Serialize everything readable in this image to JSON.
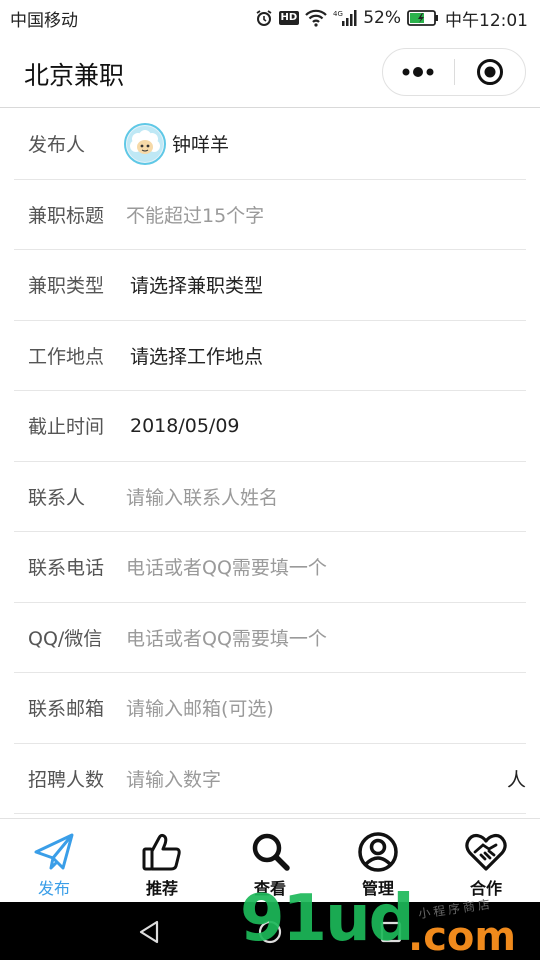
{
  "status_bar": {
    "carrier": "中国移动",
    "network": "4G",
    "battery": "52%",
    "time": "中午12:01",
    "icons": [
      "alarm-icon",
      "hd-icon",
      "wifi-icon",
      "signal-icon",
      "battery-icon"
    ]
  },
  "nav": {
    "title": "北京兼职",
    "more_icon": "more-dots-icon",
    "close_icon": "target-icon"
  },
  "form": {
    "publisher": {
      "label": "发布人",
      "name": "钟咩羊",
      "avatar_icon": "sheep-avatar-icon"
    },
    "title": {
      "label": "兼职标题",
      "placeholder": "不能超过15个字"
    },
    "type": {
      "label": "兼职类型",
      "value": "请选择兼职类型"
    },
    "location": {
      "label": "工作地点",
      "value": "请选择工作地点"
    },
    "deadline": {
      "label": "截止时间",
      "value": "2018/05/09"
    },
    "contact": {
      "label": "联系人",
      "placeholder": "请输入联系人姓名"
    },
    "phone": {
      "label": "联系电话",
      "placeholder": "电话或者QQ需要填一个"
    },
    "qq": {
      "label": "QQ/微信",
      "placeholder": "电话或者QQ需要填一个"
    },
    "email": {
      "label": "联系邮箱",
      "placeholder": "请输入邮箱(可选)"
    },
    "headcount": {
      "label": "招聘人数",
      "placeholder": "请输入数字",
      "unit": "人"
    }
  },
  "tabbar": {
    "tabs": [
      {
        "label": "发布",
        "icon": "paper-plane-icon",
        "active": true
      },
      {
        "label": "推荐",
        "icon": "thumbs-up-icon",
        "active": false
      },
      {
        "label": "查看",
        "icon": "search-icon",
        "active": false
      },
      {
        "label": "管理",
        "icon": "user-circle-icon",
        "active": false
      },
      {
        "label": "合作",
        "icon": "handshake-heart-icon",
        "active": false
      }
    ]
  },
  "colors": {
    "accent": "#3a9ee8",
    "label_gray": "#555555",
    "placeholder_gray": "#9a9a9a",
    "watermark_green": "#1db95a",
    "watermark_orange": "#f08a1c"
  },
  "watermark": {
    "brand": "91ud",
    "domain": ".com",
    "tagline": "小程序商店"
  },
  "system_nav": {
    "icons": [
      "back-icon",
      "home-icon",
      "recents-icon"
    ]
  }
}
